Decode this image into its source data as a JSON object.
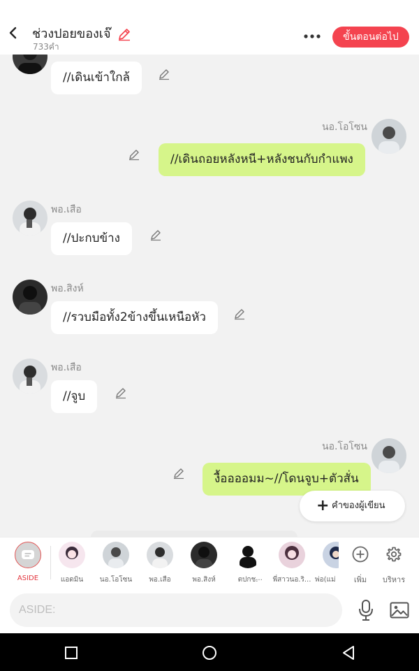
{
  "header": {
    "back_icon": "chevron-left-icon",
    "title": "ช่วงปอยของเจ๊",
    "subtitle": "733คำ",
    "more_icon": "more-horizontal-icon",
    "next_button": "ขั้นตอนต่อไป",
    "accent": "#f4434f"
  },
  "messages": [
    {
      "side": "left",
      "name": "",
      "text": "//เดินเข้าใกล้"
    },
    {
      "side": "right",
      "name": "นอ.โอโซน",
      "text": "//เดินถอยหลังหนี+หลังชนกับกำแพง"
    },
    {
      "side": "left",
      "name": "พอ.เสือ",
      "text": "//ปะกบข้าง"
    },
    {
      "side": "left",
      "name": "พอ.สิงห์",
      "text": "//รวบมือทั้ง2ข้างขึ้นเหนือหัว"
    },
    {
      "side": "left",
      "name": "พอ.เสือ",
      "text": "//จูบ"
    },
    {
      "side": "right",
      "name": "นอ.โอโซน",
      "text": "งื้ออออมม~//โดนจูบ+ตัวสั่น"
    }
  ],
  "author_note_button": "คำของผู้เขียน",
  "characters": [
    {
      "name": "ASIDE",
      "selected": true
    },
    {
      "name": "แอดมิน"
    },
    {
      "name": "นอ.โอโซน"
    },
    {
      "name": "พอ.เสือ"
    },
    {
      "name": "พอ.สิงห์"
    },
    {
      "name": "ตปกช."
    },
    {
      "name": "..."
    },
    {
      "name": "พี่สาวนอ.ริ..."
    },
    {
      "name": "พ่อ(แม่"
    }
  ],
  "tools": {
    "add_label": "เพิ่ม",
    "manage_label": "บริหาร"
  },
  "input": {
    "placeholder": "ASIDE:"
  },
  "colors": {
    "bubble_right": "#d6f58a",
    "bubble_left": "#ffffff",
    "background": "#f2f2f2"
  }
}
